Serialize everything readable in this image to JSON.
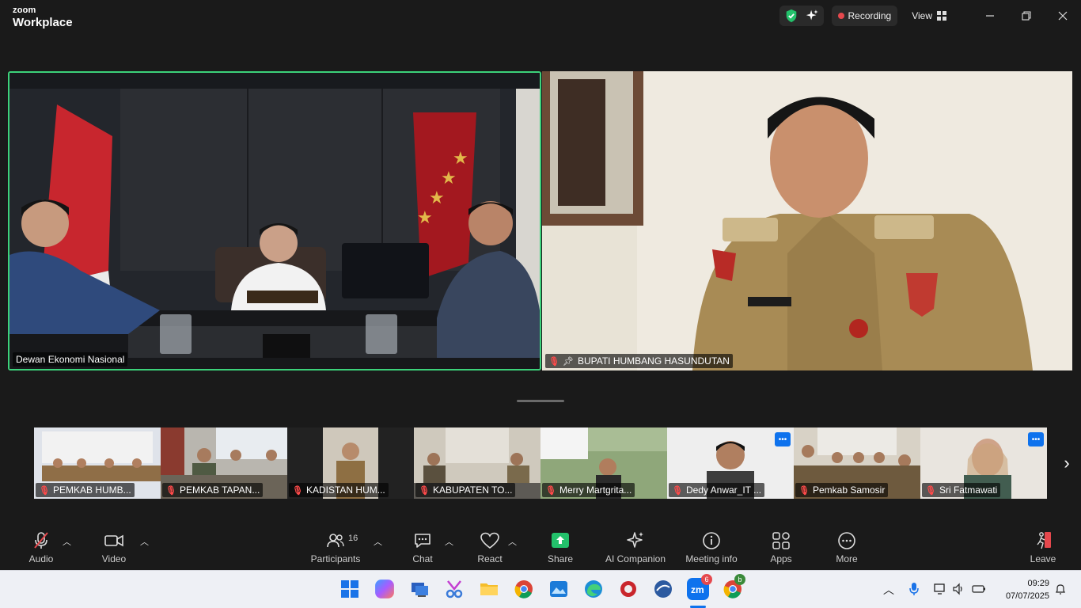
{
  "app": {
    "brand_top": "zoom",
    "brand_bottom": "Workplace",
    "recording_label": "Recording",
    "view_label": "View"
  },
  "main_tiles": [
    {
      "name": "Dewan Ekonomi Nasional",
      "muted": false,
      "active_speaker": true
    },
    {
      "name": "BUPATI HUMBANG HASUNDUTAN",
      "muted": true,
      "pinned": true
    }
  ],
  "thumbnails": [
    {
      "name": "PEMKAB HUMB...",
      "muted": true
    },
    {
      "name": "PEMKAB TAPAN...",
      "muted": true
    },
    {
      "name": "KADISTAN HUM...",
      "muted": true
    },
    {
      "name": "KABUPATEN TO...",
      "muted": true
    },
    {
      "name": "Merry Martgrita...",
      "muted": true
    },
    {
      "name": "Dedy Anwar_IT ...",
      "muted": true,
      "more_button": true
    },
    {
      "name": "Pemkab Samosir",
      "muted": true
    },
    {
      "name": "Sri Fatmawati",
      "muted": true,
      "more_button": true
    }
  ],
  "toolbar": {
    "audio": "Audio",
    "video": "Video",
    "participants": "Participants",
    "participants_count": "16",
    "chat": "Chat",
    "react": "React",
    "share": "Share",
    "ai_companion": "AI Companion",
    "meeting_info": "Meeting info",
    "apps": "Apps",
    "more": "More",
    "leave": "Leave"
  },
  "taskbar": {
    "zoom_badge": "6",
    "chrome_badge": "b",
    "time": "09:29",
    "date": "07/07/2025"
  },
  "colors": {
    "active_speaker_border": "#3cd27a",
    "muted_red": "#ff4a4a",
    "share_green": "#23c16b",
    "zoom_blue": "#0e72ed"
  }
}
